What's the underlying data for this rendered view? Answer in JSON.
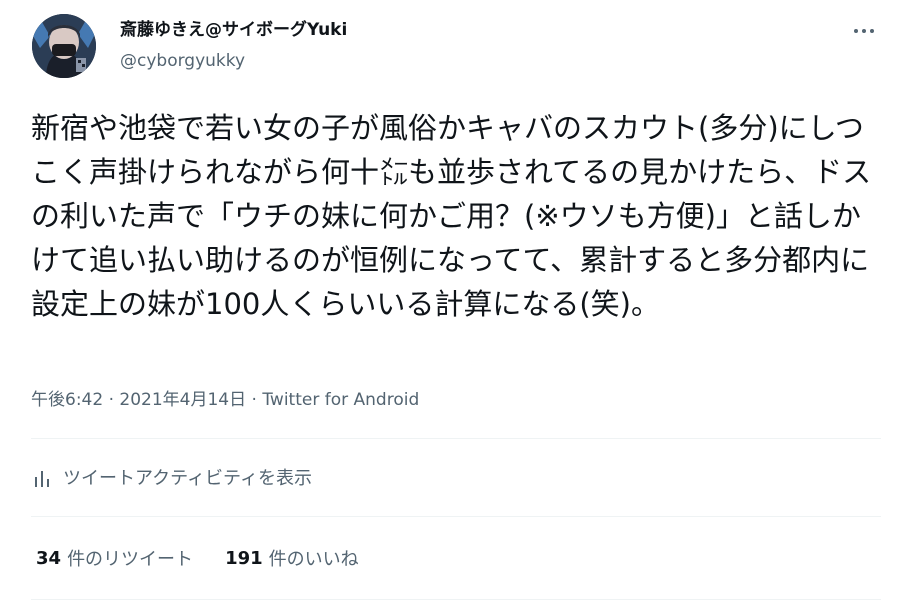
{
  "tweet": {
    "display_name": "斎藤ゆきえ@サイボーグYuki",
    "handle": "@cyborgyukky",
    "text": "新宿や池袋で若い女の子が風俗かキャバのスカウト(多分)にしつこく声掛けられながら何十㍍も並歩されてるの見かけたら、ドスの利いた声で「ウチの妹に何かご用？(※ウソも方便)」と話しかけて追い払い助けるのが恒例になってて、累計すると多分都内に設定上の妹が100人くらいいる計算になる(笑)。",
    "time": "午後6:42",
    "separator": "·",
    "date": "2021年4月14日",
    "source": "Twitter for Android",
    "analytics_label": "ツイートアクティビティを表示",
    "retweets": {
      "count": "34",
      "label": "件のリツイート"
    },
    "likes": {
      "count": "191",
      "label": "件のいいね"
    }
  },
  "icons": {
    "more": "more-horizontal-icon",
    "analytics": "bar-chart-icon"
  },
  "colors": {
    "text": "#0f1419",
    "secondary": "#536471",
    "divider": "#eff3f4"
  }
}
